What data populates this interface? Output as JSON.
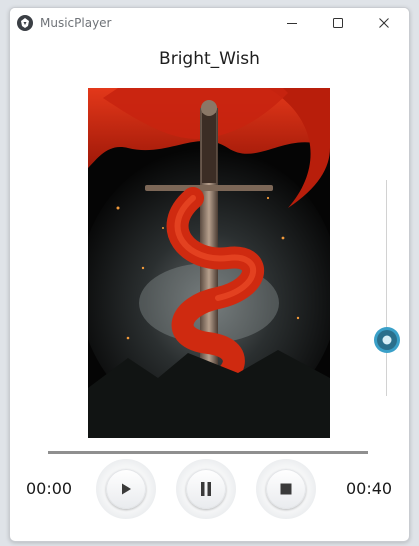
{
  "window": {
    "title": "MusicPlayer",
    "icon": "app-logo-icon",
    "controls": [
      "minimize-icon",
      "maximize-icon",
      "close-icon"
    ]
  },
  "track": {
    "title": "Bright_Wish",
    "cover_art": "sword-with-red-cloth-artwork"
  },
  "player": {
    "current_time": "00:00",
    "total_time": "00:40",
    "progress_fraction": 0,
    "volume_fraction": 0.26,
    "buttons": {
      "play": "play-icon",
      "pause": "pause-icon",
      "stop": "stop-icon"
    }
  },
  "colors": {
    "accent": "#3aa0c8",
    "knob_center": "#2a6f8c",
    "progress": "#8f8f8f",
    "cloth_red": "#c8230f"
  }
}
